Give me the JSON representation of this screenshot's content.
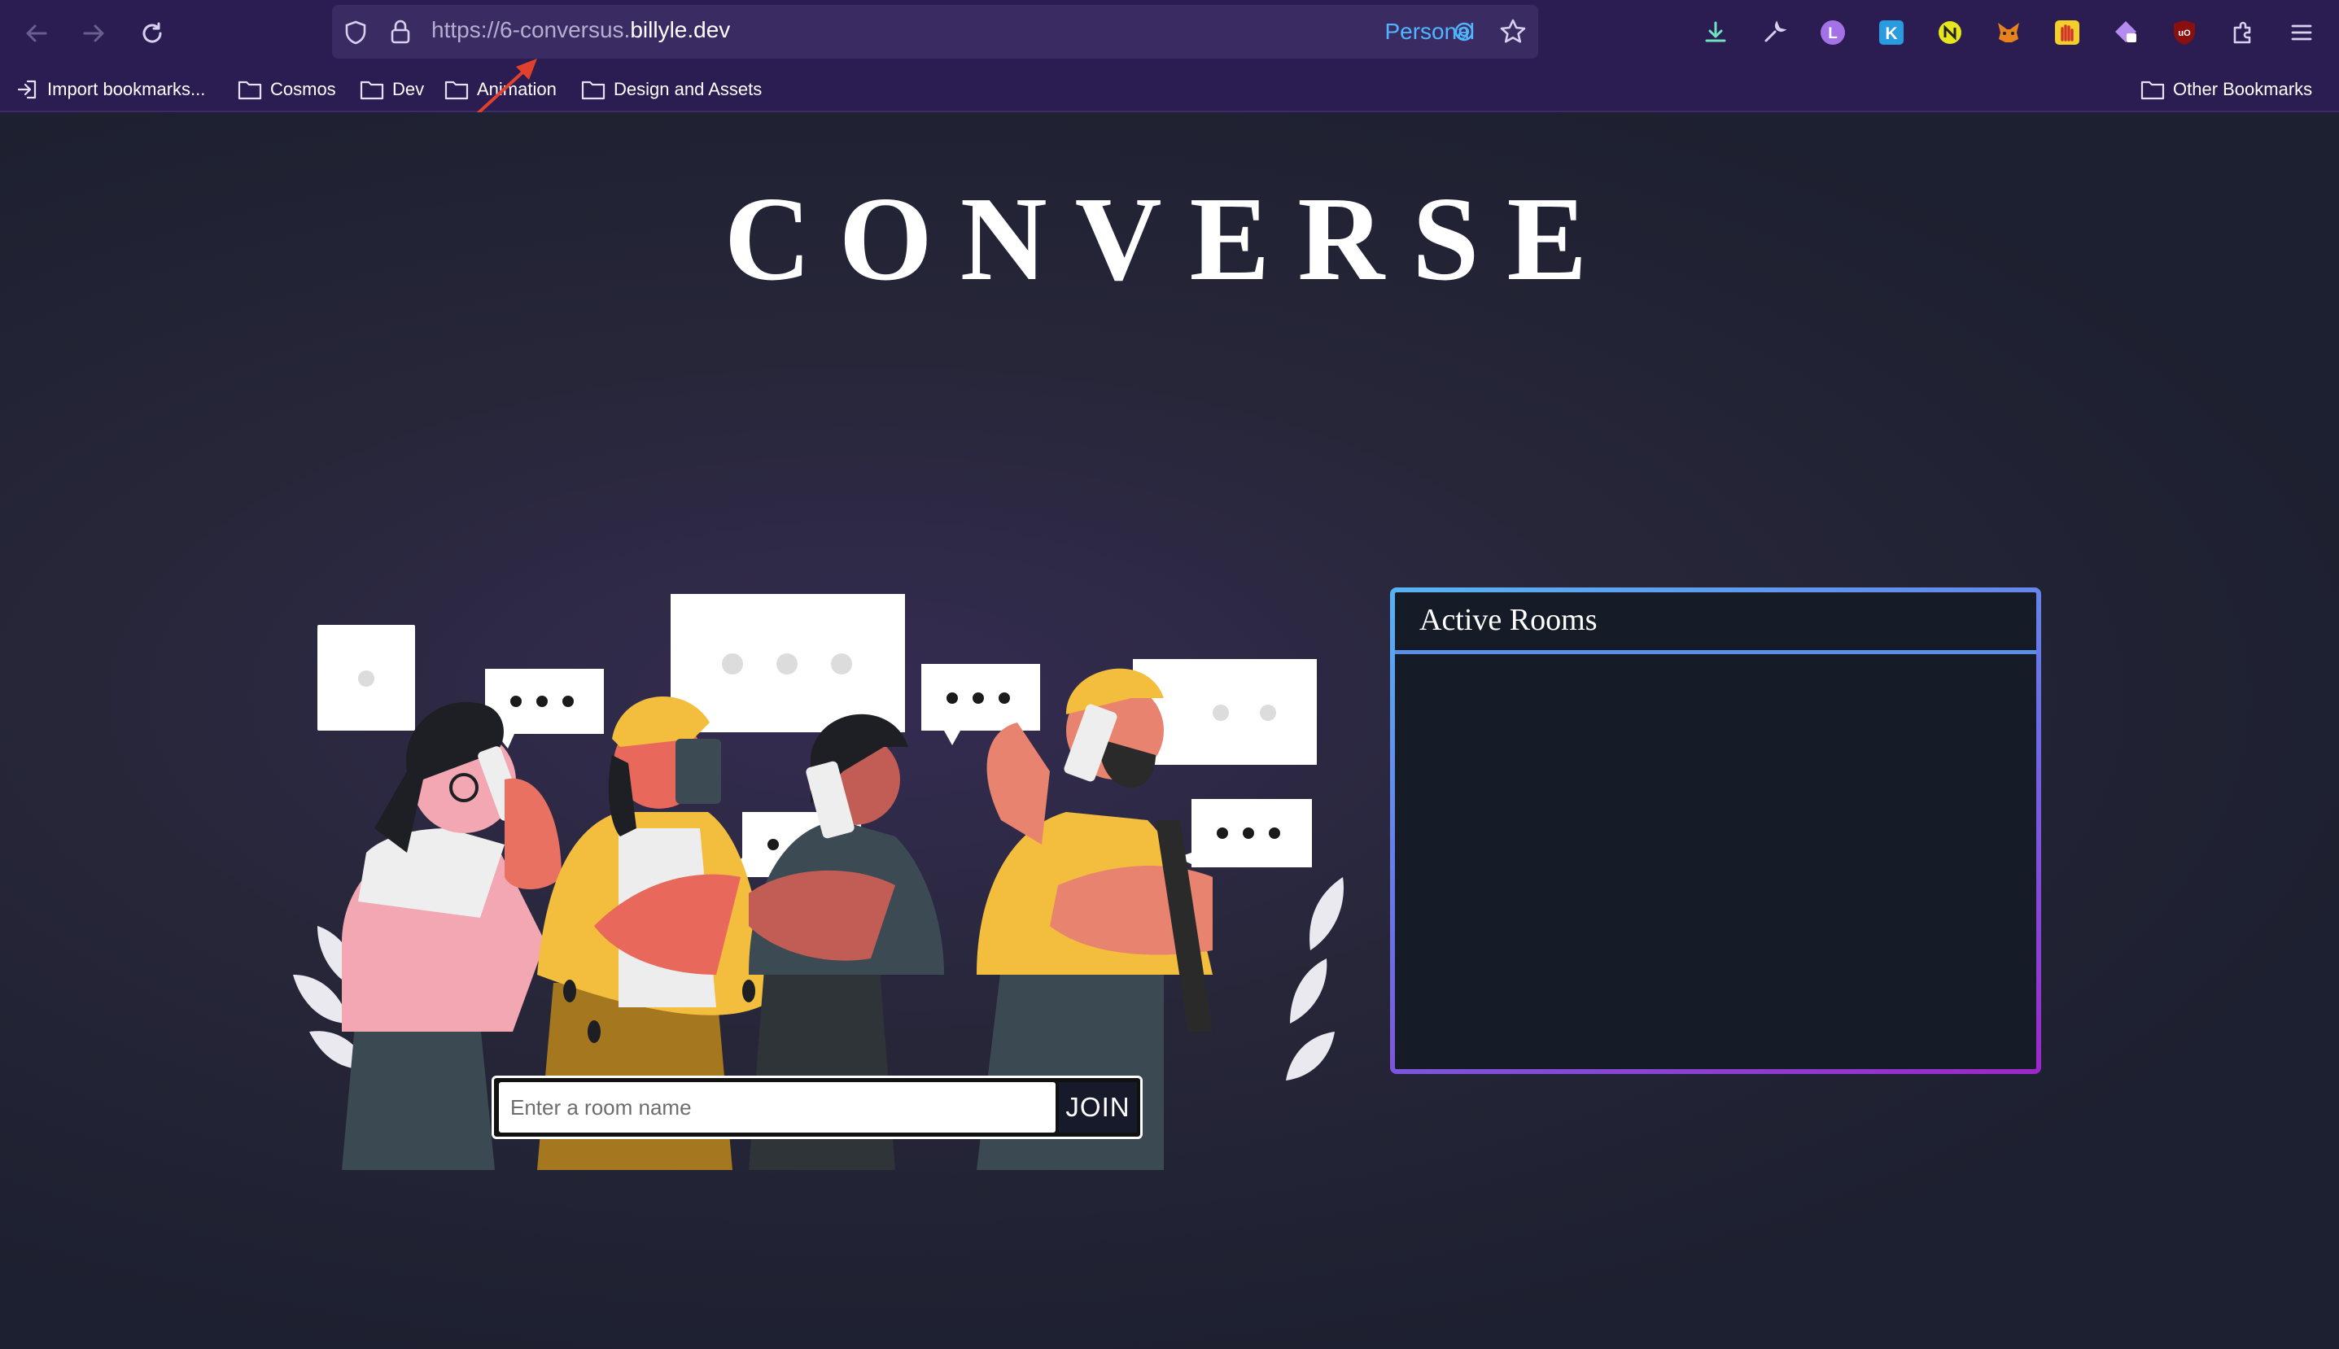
{
  "browser": {
    "url_prefix": "https://6-conversus.",
    "url_domain": "billyle.dev",
    "container_label": "Personal",
    "bookmarks": [
      {
        "label": "Import bookmarks..."
      },
      {
        "label": "Cosmos"
      },
      {
        "label": "Dev"
      },
      {
        "label": "Animation"
      },
      {
        "label": "Design and Assets"
      }
    ],
    "other_bookmarks": "Other Bookmarks",
    "extension_letters": {
      "profile": "L",
      "k": "K",
      "ub": "uO"
    }
  },
  "page": {
    "title": "CONVERSE",
    "join": {
      "placeholder": "Enter a room name",
      "button_label": "JOIN"
    },
    "rooms": {
      "header": "Active Rooms",
      "items": []
    }
  },
  "colors": {
    "chrome_bg": "#2b1d52",
    "page_bg": "#1f2131",
    "rooms_border_start": "#58b3f2",
    "rooms_border_end": "#9c27c8"
  }
}
